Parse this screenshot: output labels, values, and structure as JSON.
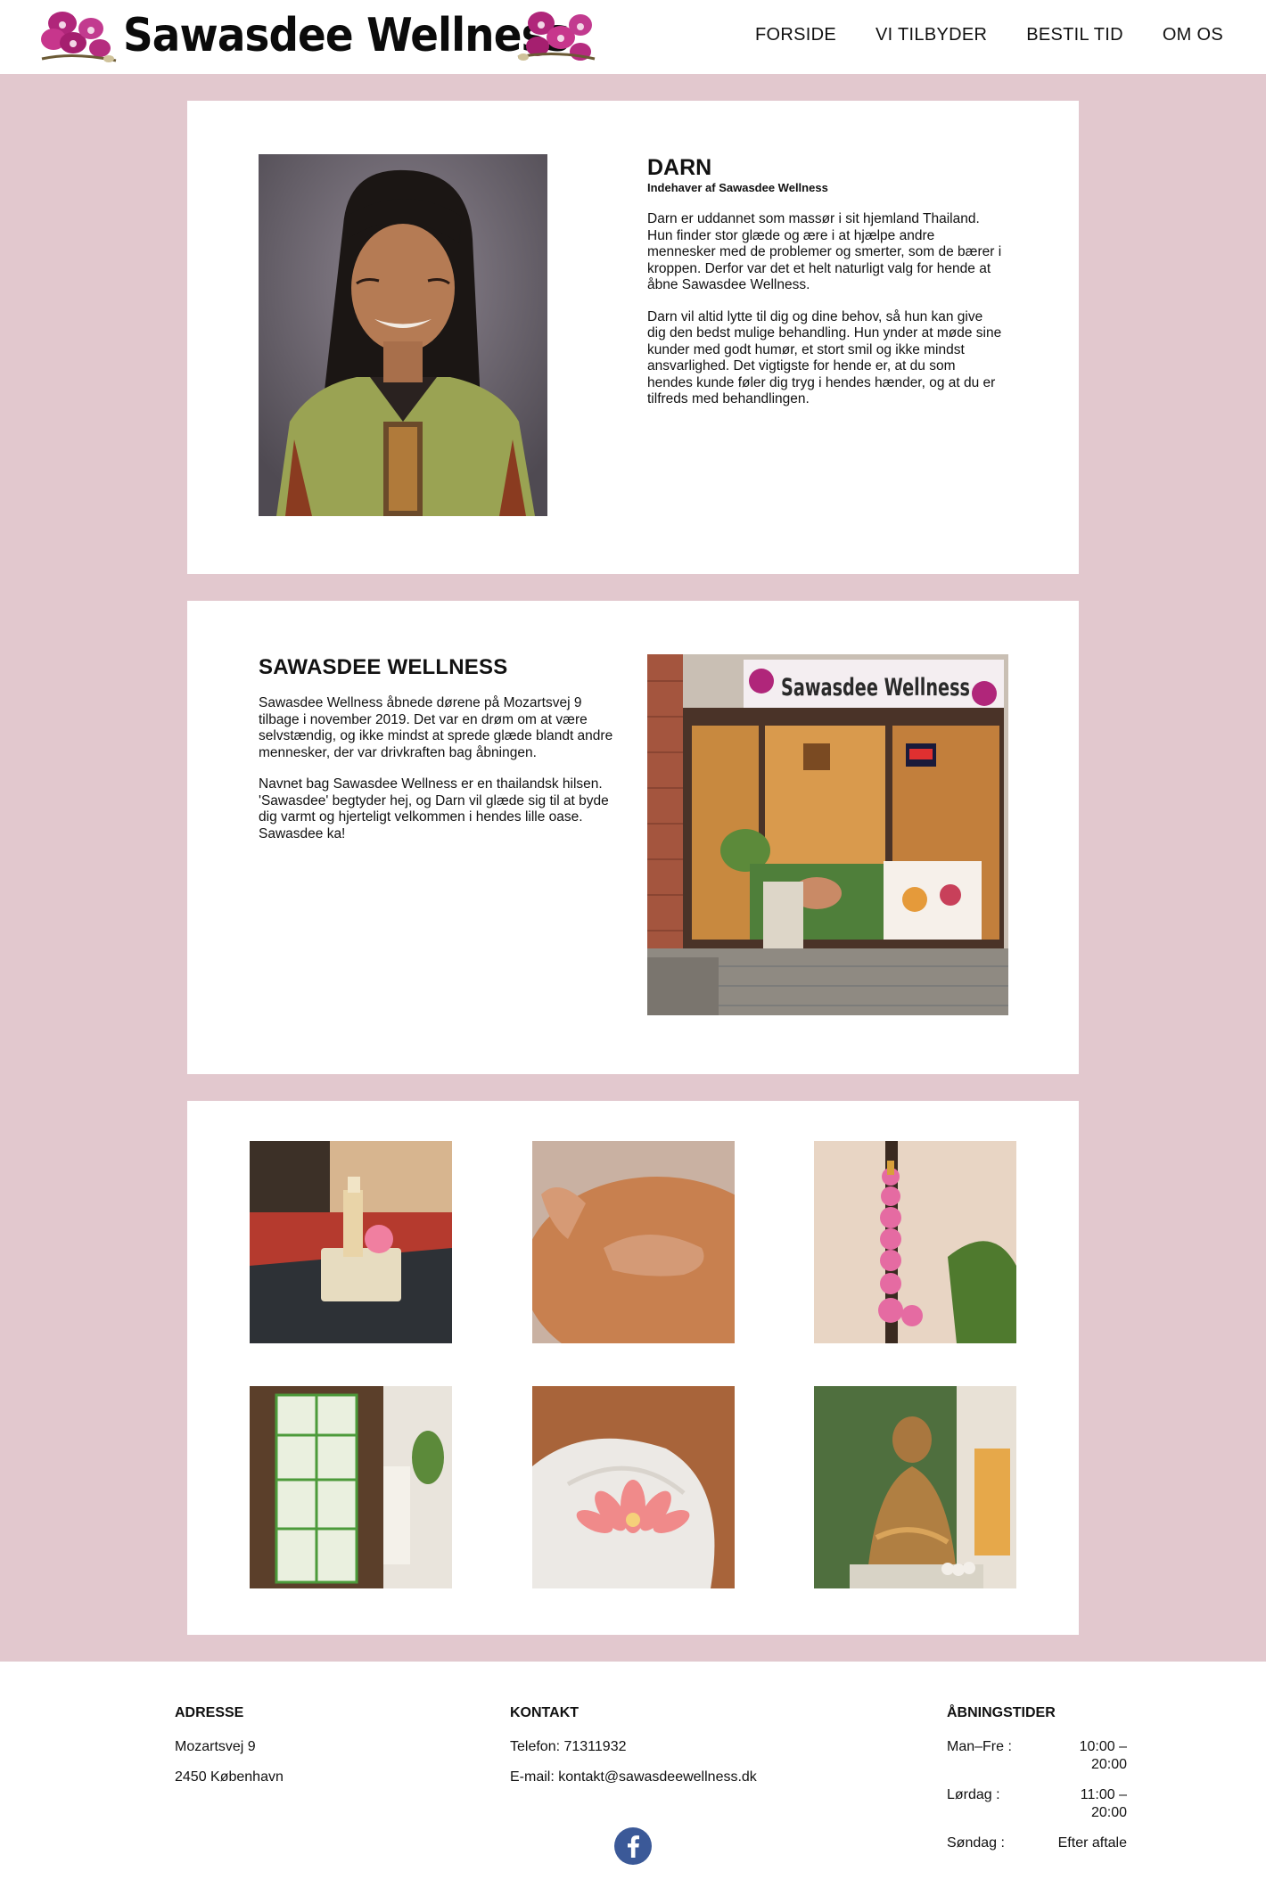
{
  "header": {
    "logo_text": "Sawasdee Wellness",
    "nav": [
      "FORSIDE",
      "VI TILBYDER",
      "BESTIL TID",
      "OM OS"
    ]
  },
  "owner": {
    "name": "DARN",
    "subtitle": "Indehaver af Sawasdee Wellness",
    "paragraphs": [
      "Darn er uddannet som massør i sit hjemland Thailand. Hun finder stor glæde og ære i at hjælpe andre mennesker med de problemer og smerter, som de bærer i kroppen. Derfor var det et helt naturligt valg for hende at åbne Sawasdee Wellness.",
      "Darn vil altid lytte til dig og dine behov, så hun kan give dig den bedst mulige behandling. Hun ynder at møde sine kunder med godt humør, et stort smil og ikke mindst ansvarlighed. Det vigtigste for hende er, at du som hendes kunde føler dig tryg i hendes hænder, og at du er tilfreds med behandlingen."
    ]
  },
  "about": {
    "title": "SAWASDEE WELLNESS",
    "paragraphs": [
      "Sawasdee Wellness åbnede dørene på Mozartsvej 9 tilbage i november 2019. Det var en drøm om at være selvstændig, og ikke mindst at sprede glæde blandt andre mennesker, der var drivkraften bag åbningen.",
      "Navnet bag Sawasdee Wellness er en thailandsk hilsen. 'Sawasdee' begtyder hej, og Darn vil glæde sig til at byde dig varmt og hjerteligt velkommen i hendes lille oase. Sawasdee ka!"
    ],
    "shop_sign": "Sawasdee Wellness"
  },
  "footer": {
    "address": {
      "heading": "ADRESSE",
      "street": "Mozartsvej 9",
      "city": "2450 København"
    },
    "contact": {
      "heading": "KONTAKT",
      "phone": "Telefon: 71311932",
      "email": "E-mail: kontakt@sawasdeewellness.dk"
    },
    "hours": {
      "heading": "ÅBNINGSTIDER",
      "rows": [
        {
          "day": "Man–Fre :",
          "time": "10:00 – 20:00"
        },
        {
          "day": "Lørdag :",
          "time": "11:00 – 20:00"
        },
        {
          "day": "Søndag :",
          "time": "Efter aftale"
        }
      ]
    }
  },
  "colors": {
    "page_bg": "#e2c8ce",
    "card_bg": "#ffffff",
    "facebook": "#3b5998"
  },
  "icons": [
    "orchid-icon",
    "facebook-icon"
  ]
}
